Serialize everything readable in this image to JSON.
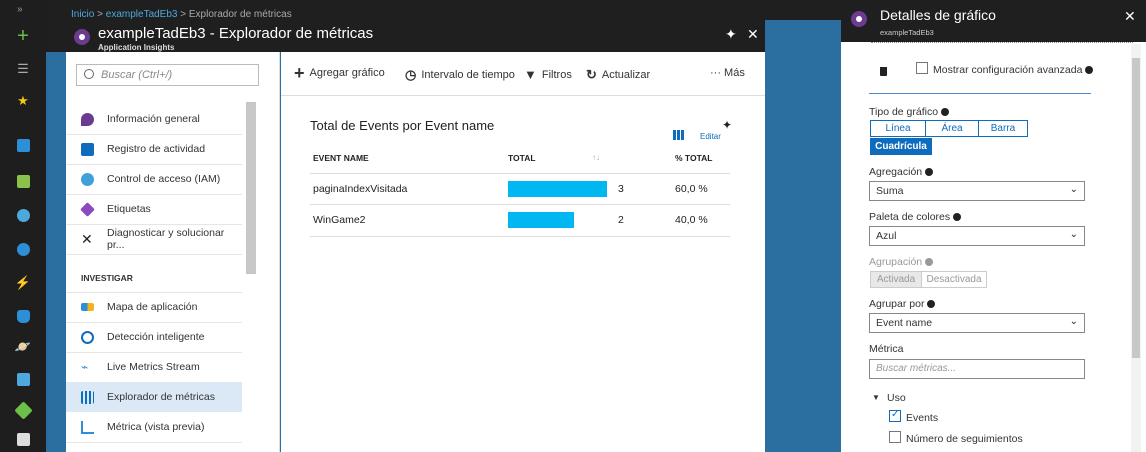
{
  "breadcrumb": {
    "home": "Inicio",
    "sep": ">",
    "resource": "exampleTadEb3",
    "page": "Explorador de métricas"
  },
  "blade": {
    "title": "exampleTadEb3 - Explorador de métricas",
    "subtitle": "Application Insights"
  },
  "menu": {
    "search_placeholder": "Buscar (Ctrl+/)",
    "items": [
      {
        "label": "Información general",
        "icon": "pin-location-icon",
        "color": "#6b3b8f"
      },
      {
        "label": "Registro de actividad",
        "icon": "activity-log-icon",
        "color": "#0f6cbd"
      },
      {
        "label": "Control de acceso (IAM)",
        "icon": "users-icon",
        "color": "#40a0d8"
      },
      {
        "label": "Etiquetas",
        "icon": "tag-icon",
        "color": "#8a4bbf"
      },
      {
        "label": "Diagnosticar y solucionar pr...",
        "icon": "wrench-icon",
        "color": "#333333"
      }
    ],
    "section": "INVESTIGAR",
    "investigate": [
      {
        "label": "Mapa de aplicación",
        "icon": "app-map-icon",
        "color": "#f2b31b"
      },
      {
        "label": "Detección inteligente",
        "icon": "smart-detection-icon",
        "color": "#0f6cbd"
      },
      {
        "label": "Live Metrics Stream",
        "icon": "pulse-icon",
        "color": "#2d8fd6"
      },
      {
        "label": "Explorador de métricas",
        "icon": "metrics-chart-icon",
        "color": "#0f6cbd",
        "selected": true
      },
      {
        "label": "Métrica (vista previa)",
        "icon": "metric-preview-icon",
        "color": "#2d8fd6"
      }
    ]
  },
  "toolbar": {
    "add_chart": "Agregar gráfico",
    "time_range": "Intervalo de tiempo",
    "filters": "Filtros",
    "refresh": "Actualizar",
    "more": "··· Más"
  },
  "grid": {
    "title": "Total de Events por Event name",
    "edit": "Editar",
    "columns": {
      "name": "EVENT NAME",
      "total": "TOTAL",
      "sort": "↑↓",
      "pct": "% TOTAL"
    },
    "rows": [
      {
        "name": "paginaIndexVisitada",
        "total": "3",
        "share": 0.6,
        "pct": "60,0 %"
      },
      {
        "name": "WinGame2",
        "total": "2",
        "share": 0.4,
        "pct": "40,0 %"
      }
    ],
    "bar_color": "#00b7f1"
  },
  "panel": {
    "title": "Detalles de gráfico",
    "subtitle": "exampleTadEb3",
    "advanced": "Mostrar configuración avanzada",
    "chart_type_label": "Tipo de gráfico",
    "chart_types": [
      "Línea",
      "Área",
      "Barra",
      "Cuadrícula"
    ],
    "chart_type_selected": "Cuadrícula",
    "aggregation_label": "Agregación",
    "aggregation": "Suma",
    "palette_label": "Paleta de colores",
    "palette": "Azul",
    "grouping_label": "Agrupación",
    "grouping_on": "Activada",
    "grouping_off": "Desactivada",
    "group_by_label": "Agrupar por",
    "group_by": "Event name",
    "metric_label": "Métrica",
    "metric_placeholder": "Buscar métricas...",
    "group_node": "Uso",
    "metrics": [
      {
        "label": "Events",
        "checked": true
      },
      {
        "label": "Número de seguimientos",
        "checked": false
      }
    ],
    "accent": "#0f6cbd"
  }
}
